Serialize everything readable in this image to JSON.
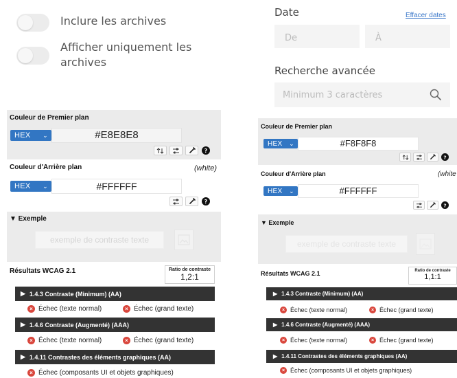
{
  "toggles": [
    {
      "label": "Inclure les archives",
      "on": false
    },
    {
      "label_line1": "Afficher uniquement les",
      "label_line2": "archives",
      "on": false
    }
  ],
  "search": {
    "date_title": "Date",
    "clear_label": "Effacer dates",
    "from_placeholder": "De",
    "to_placeholder": "À",
    "advanced_title": "Recherche avancée",
    "advanced_placeholder": "Minimum 3 caractères",
    "search_icon": "magnifier-icon"
  },
  "checkers": [
    {
      "id": "left",
      "foreground_label": "Couleur de Premier plan",
      "foreground_format": "HEX",
      "foreground_value": "#E8E8E8",
      "background_label": "Couleur d'Arrière plan",
      "background_note": "(white)",
      "background_format": "HEX",
      "background_value": "#FFFFFF",
      "example_label": "▼ Exemple",
      "example_placeholder": "exemple de contraste texte",
      "results_label": "Résultats WCAG 2.1",
      "ratio_label": "Ratio de contraste",
      "ratio_value": "1,2:1",
      "criteria": [
        {
          "title": "1.4.3 Contraste (Minimum) (AA)",
          "results": [
            "Échec (texte normal)",
            "Échec (grand texte)"
          ]
        },
        {
          "title": "1.4.6 Contraste (Augmenté) (AAA)",
          "results": [
            "Échec (texte normal)",
            "Échec (grand texte)"
          ]
        },
        {
          "title": "1.4.11 Contrastes des éléments graphiques (AA)",
          "results": [
            "Échec (composants UI et objets graphiques)"
          ]
        }
      ]
    },
    {
      "id": "right",
      "foreground_label": "Couleur de Premier plan",
      "foreground_format": "HEX",
      "foreground_value": "#F8F8F8",
      "background_label": "Couleur d'Arrière plan",
      "background_note": "(white",
      "background_format": "HEX",
      "background_value": "#FFFFFF",
      "example_label": "▼ Exemple",
      "example_placeholder": "exemple de contraste texte",
      "results_label": "Résultats WCAG 2.1",
      "ratio_label": "Ratio de contraste",
      "ratio_value": "1,1:1",
      "criteria": [
        {
          "title": "1.4.3 Contraste (Minimum) (AA)",
          "results": [
            "Échec (texte normal)",
            "Échec (grand texte)"
          ]
        },
        {
          "title": "1.4.6 Contraste (Augmenté) (AAA)",
          "results": [
            "Échec (texte normal)",
            "Échec (grand texte)"
          ]
        },
        {
          "title": "1.4.11 Contrastes des éléments graphiques (AA)",
          "results": [
            "Échec (composants UI et objets graphiques)"
          ]
        }
      ]
    }
  ],
  "colors": {
    "accent": "#3276c3",
    "fail": "#d9463c",
    "bar": "#333333",
    "section": "#ebebeb"
  }
}
